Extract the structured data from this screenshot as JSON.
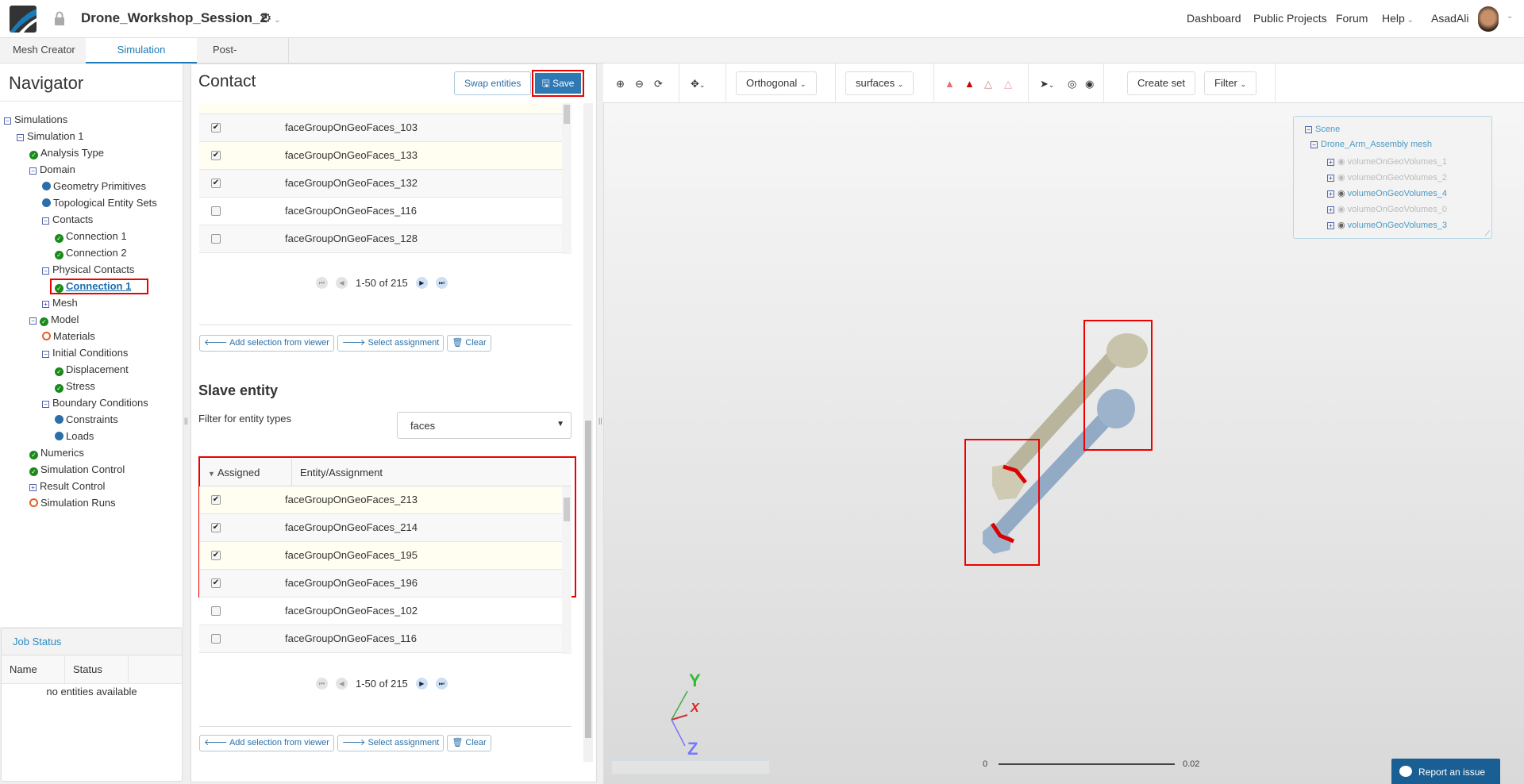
{
  "header": {
    "project": "Drone_Workshop_Session_2",
    "nav": [
      "Dashboard",
      "Public Projects",
      "Forum",
      "Help"
    ],
    "user": "AsadAli"
  },
  "tabs": [
    "Mesh Creator",
    "Simulation Designer",
    "Post-Processor"
  ],
  "navigator": {
    "title": "Navigator",
    "tree": [
      {
        "label": "Simulations",
        "icon": "minus",
        "level": 0
      },
      {
        "label": "Simulation 1",
        "icon": "minus",
        "level": 1
      },
      {
        "label": "Analysis Type",
        "icon": "check",
        "level": 2
      },
      {
        "label": "Domain",
        "icon": "minus",
        "level": 2
      },
      {
        "label": "Geometry Primitives",
        "icon": "dot",
        "level": 3
      },
      {
        "label": "Topological Entity Sets",
        "icon": "dot",
        "level": 3
      },
      {
        "label": "Contacts",
        "icon": "minus",
        "level": 3
      },
      {
        "label": "Connection 1",
        "icon": "check",
        "level": 4
      },
      {
        "label": "Connection 2",
        "icon": "check",
        "level": 4
      },
      {
        "label": "Physical Contacts",
        "icon": "minus",
        "level": 3
      },
      {
        "label": "Connection 1",
        "icon": "check",
        "level": 4,
        "selected": true
      },
      {
        "label": "Mesh",
        "icon": "plus",
        "level": 3
      },
      {
        "label": "Model",
        "icon": "minus-check",
        "level": 2
      },
      {
        "label": "Materials",
        "icon": "ring",
        "level": 3
      },
      {
        "label": "Initial Conditions",
        "icon": "minus",
        "level": 3
      },
      {
        "label": "Displacement",
        "icon": "check",
        "level": 4
      },
      {
        "label": "Stress",
        "icon": "check",
        "level": 4
      },
      {
        "label": "Boundary Conditions",
        "icon": "minus",
        "level": 3
      },
      {
        "label": "Constraints",
        "icon": "dot",
        "level": 4
      },
      {
        "label": "Loads",
        "icon": "dot",
        "level": 4
      },
      {
        "label": "Numerics",
        "icon": "check",
        "level": 2
      },
      {
        "label": "Simulation Control",
        "icon": "check",
        "level": 2
      },
      {
        "label": "Result Control",
        "icon": "plus",
        "level": 2
      },
      {
        "label": "Simulation Runs",
        "icon": "ring",
        "level": 2
      }
    ]
  },
  "job_status": {
    "title": "Job Status",
    "columns": [
      "Name",
      "Status"
    ],
    "empty": "no entities available"
  },
  "contact": {
    "title": "Contact",
    "swap": "Swap entities",
    "save": "Save",
    "master": {
      "rows": [
        {
          "name": "faceGroupOnGeoFaces_103",
          "checked": true
        },
        {
          "name": "faceGroupOnGeoFaces_133",
          "checked": true
        },
        {
          "name": "faceGroupOnGeoFaces_132",
          "checked": true
        },
        {
          "name": "faceGroupOnGeoFaces_116",
          "checked": false
        },
        {
          "name": "faceGroupOnGeoFaces_128",
          "checked": false
        }
      ],
      "pager": "1-50 of 215"
    },
    "actions": {
      "add": "Add selection from viewer",
      "select": "Select assignment",
      "clear": "Clear"
    },
    "slave": {
      "title": "Slave entity",
      "filter_label": "Filter for entity types",
      "filter_value": "faces",
      "columns": [
        "Assigned",
        "Entity/Assignment"
      ],
      "rows": [
        {
          "name": "faceGroupOnGeoFaces_213",
          "checked": true
        },
        {
          "name": "faceGroupOnGeoFaces_214",
          "checked": true
        },
        {
          "name": "faceGroupOnGeoFaces_195",
          "checked": true
        },
        {
          "name": "faceGroupOnGeoFaces_196",
          "checked": true
        },
        {
          "name": "faceGroupOnGeoFaces_102",
          "checked": false
        },
        {
          "name": "faceGroupOnGeoFaces_116",
          "checked": false
        }
      ],
      "pager": "1-50 of 215"
    }
  },
  "viewer": {
    "projection": "Orthogonal",
    "render": "surfaces",
    "create_set": "Create set",
    "filter": "Filter",
    "scene": {
      "root": "Scene",
      "mesh": "Drone_Arm_Assembly mesh",
      "volumes": [
        {
          "name": "volumeOnGeoVolumes_1",
          "visible": false
        },
        {
          "name": "volumeOnGeoVolumes_2",
          "visible": false
        },
        {
          "name": "volumeOnGeoVolumes_4",
          "visible": true
        },
        {
          "name": "volumeOnGeoVolumes_0",
          "visible": false
        },
        {
          "name": "volumeOnGeoVolumes_3",
          "visible": true
        }
      ]
    },
    "axes": {
      "y": "Y",
      "x": "X",
      "z": "Z"
    },
    "scale": {
      "min": "0",
      "max": "0.02"
    },
    "report": "Report an issue"
  }
}
